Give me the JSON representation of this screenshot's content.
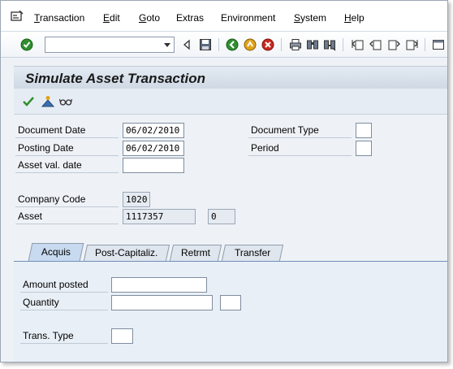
{
  "menu": {
    "items": [
      {
        "key": "transaction",
        "first": "T",
        "rest": "ransaction"
      },
      {
        "key": "edit",
        "first": "E",
        "rest": "dit"
      },
      {
        "key": "goto",
        "first": "G",
        "rest": "oto"
      },
      {
        "key": "extras",
        "first": "E",
        "rest": "xtras",
        "pre": "Extr",
        "label": "Extras"
      },
      {
        "key": "environment",
        "first": "E",
        "rest": "nvironment",
        "label": "Environment"
      },
      {
        "key": "system",
        "first": "S",
        "rest": "ystem"
      },
      {
        "key": "help",
        "first": "H",
        "rest": "elp"
      }
    ]
  },
  "toolbar": {
    "command_field_value": "",
    "icons": [
      "enter-icon",
      "back-icon",
      "save-icon",
      "back-nav-icon",
      "exit-icon",
      "cancel-icon",
      "print-icon",
      "find-icon",
      "find-next-icon",
      "first-page-icon",
      "previous-page-icon",
      "next-page-icon",
      "last-page-icon"
    ]
  },
  "title": "Simulate Asset Transaction",
  "app_toolbar": {
    "icons": [
      "check-icon",
      "line-items-icon",
      "glasses-icon"
    ]
  },
  "header": {
    "document_date_label": "Document Date",
    "document_date_value": "06/02/2010",
    "posting_date_label": "Posting Date",
    "posting_date_value": "06/02/2010",
    "asset_val_date_label": "Asset val. date",
    "asset_val_date_value": "",
    "document_type_label": "Document Type",
    "document_type_value": "",
    "period_label": "Period",
    "period_value": "",
    "company_code_label": "Company Code",
    "company_code_value": "1020",
    "asset_label": "Asset",
    "asset_value": "1117357",
    "asset_subnumber": "0"
  },
  "tabs": [
    {
      "label": "Acquis",
      "active": true
    },
    {
      "label": "Post-Capitaliz.",
      "active": false
    },
    {
      "label": "Retrmt",
      "active": false
    },
    {
      "label": "Transfer",
      "active": false
    }
  ],
  "acquis_panel": {
    "amount_posted_label": "Amount posted",
    "amount_posted_value": "",
    "quantity_label": "Quantity",
    "quantity_value": "",
    "quantity_unit_value": "",
    "trans_type_label": "Trans. Type",
    "trans_type_value": ""
  }
}
